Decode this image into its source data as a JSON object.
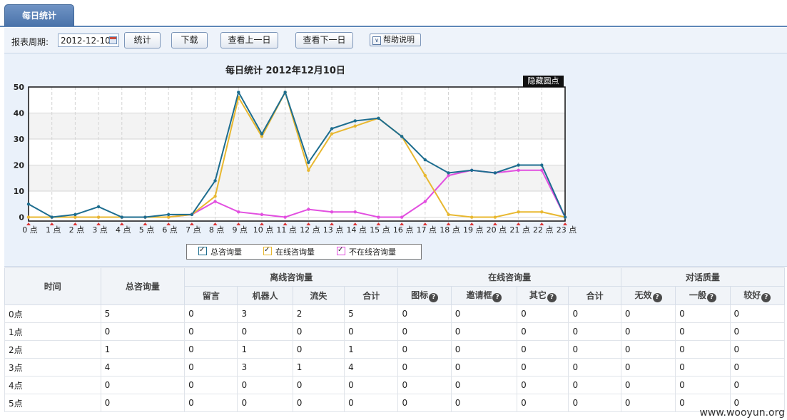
{
  "tab": {
    "label": "每日统计"
  },
  "toolbar": {
    "period_label": "报表周期:",
    "date_value": "2012-12-10",
    "btn_stats": "统计",
    "btn_download": "下载",
    "btn_prev": "查看上一日",
    "btn_next": "查看下一日",
    "btn_help": "帮助说明"
  },
  "chart": {
    "title": "每日统计  2012年12月10日",
    "hide_dots": "隐藏圆点",
    "legend": [
      {
        "label": "总咨询量",
        "color": "#1d6d8f"
      },
      {
        "label": "在线咨询量",
        "color": "#e8b830"
      },
      {
        "label": "不在线咨询量",
        "color": "#e24fe0"
      }
    ]
  },
  "chart_data": {
    "type": "line",
    "title": "每日统计  2012年12月10日",
    "x": [
      "0 点",
      "1 点",
      "2 点",
      "3 点",
      "4 点",
      "5 点",
      "6 点",
      "7 点",
      "8 点",
      "9 点",
      "10 点",
      "11 点",
      "12 点",
      "13 点",
      "14 点",
      "15 点",
      "16 点",
      "17 点",
      "18 点",
      "19 点",
      "20 点",
      "21 点",
      "22 点",
      "23 点"
    ],
    "y_ticks": [
      "0",
      "10",
      "20",
      "30",
      "40",
      "50"
    ],
    "ylim": [
      -1.5,
      50
    ],
    "grid": true,
    "series": [
      {
        "name": "总咨询量",
        "color": "#1d6d8f",
        "values": [
          5,
          0,
          1,
          4,
          0,
          0,
          1,
          1,
          14,
          48,
          32,
          48,
          21,
          34,
          37,
          38,
          31,
          22,
          17,
          18,
          17,
          20,
          20,
          0
        ]
      },
      {
        "name": "在线咨询量",
        "color": "#e8b830",
        "values": [
          0,
          0,
          0,
          0,
          0,
          0,
          0,
          1,
          8,
          46,
          31,
          48,
          18,
          32,
          35,
          38,
          31,
          16,
          1,
          0,
          0,
          2,
          2,
          0
        ]
      },
      {
        "name": "不在线咨询量",
        "color": "#e24fe0",
        "values": [
          0,
          0,
          0,
          0,
          0,
          0,
          0,
          1,
          6,
          2,
          1,
          0,
          3,
          2,
          2,
          0,
          0,
          6,
          16,
          18,
          17,
          18,
          18,
          0
        ]
      }
    ]
  },
  "table": {
    "headers": {
      "time": "时间",
      "total": "总咨询量",
      "offline": "离线咨询量",
      "online": "在线咨询量",
      "quality": "对话质量",
      "offline_sub": [
        "留言",
        "机器人",
        "流失",
        "合计"
      ],
      "online_sub": [
        "图标",
        "邀请框",
        "其它",
        "合计"
      ],
      "quality_sub": [
        "无效",
        "一般",
        "较好"
      ],
      "help_mark": "?"
    },
    "rows": [
      [
        "0点",
        "5",
        "0",
        "3",
        "2",
        "5",
        "0",
        "0",
        "0",
        "0",
        "0",
        "0",
        "0"
      ],
      [
        "1点",
        "0",
        "0",
        "0",
        "0",
        "0",
        "0",
        "0",
        "0",
        "0",
        "0",
        "0",
        "0"
      ],
      [
        "2点",
        "1",
        "0",
        "1",
        "0",
        "1",
        "0",
        "0",
        "0",
        "0",
        "0",
        "0",
        "0"
      ],
      [
        "3点",
        "4",
        "0",
        "3",
        "1",
        "4",
        "0",
        "0",
        "0",
        "0",
        "0",
        "0",
        "0"
      ],
      [
        "4点",
        "0",
        "0",
        "0",
        "0",
        "0",
        "0",
        "0",
        "0",
        "0",
        "0",
        "0",
        "0"
      ],
      [
        "5点",
        "0",
        "0",
        "0",
        "0",
        "0",
        "0",
        "0",
        "0",
        "0",
        "0",
        "0",
        "0"
      ]
    ]
  },
  "watermark": "www.wooyun.org"
}
